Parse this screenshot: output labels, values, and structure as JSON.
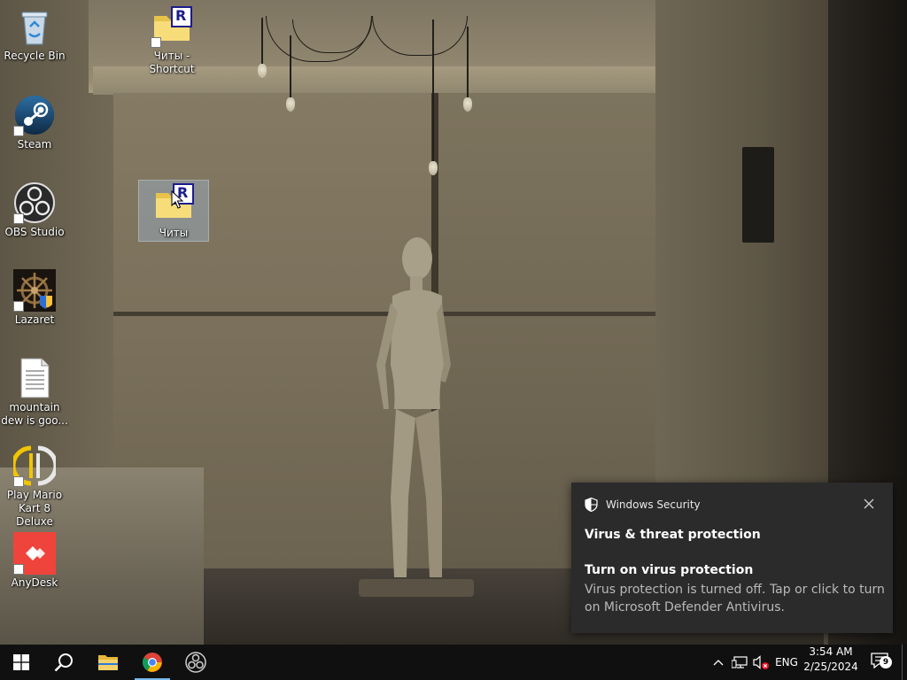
{
  "desktop": {
    "icons": [
      {
        "label": "Recycle Bin",
        "icon": "recycle-bin-icon"
      },
      {
        "label": "Читы - Shortcut",
        "icon": "folder-shortcut-icon"
      },
      {
        "label": "Steam",
        "icon": "steam-icon"
      },
      {
        "label": "Читы",
        "icon": "folder-icon"
      },
      {
        "label": "OBS Studio",
        "icon": "obs-icon"
      },
      {
        "label": "Lazaret",
        "icon": "lazaret-icon"
      },
      {
        "label": "mountain dew is goo...",
        "icon": "text-file-icon"
      },
      {
        "label": "Play Mario Kart 8 Deluxe",
        "icon": "yuzu-icon"
      },
      {
        "label": "AnyDesk",
        "icon": "anydesk-icon"
      }
    ],
    "folder_badge": "R"
  },
  "toast": {
    "app": "Windows Security",
    "title": "Virus & threat protection",
    "subtitle": "Turn on virus protection",
    "body": "Virus protection is turned off. Tap or click to turn on Microsoft Defender Antivirus."
  },
  "taskbar": {
    "pinned": [
      "start-icon",
      "search-icon",
      "file-explorer-icon",
      "chrome-icon",
      "obs-icon"
    ],
    "tray": {
      "language": "ENG",
      "time": "3:54 AM",
      "date": "2/25/2024",
      "notification_count": "9"
    }
  },
  "colors": {
    "taskbar": "#101010",
    "toast_bg": "#2b2b2b",
    "active_indicator": "#76b9ed",
    "anydesk": "#ef443b"
  }
}
